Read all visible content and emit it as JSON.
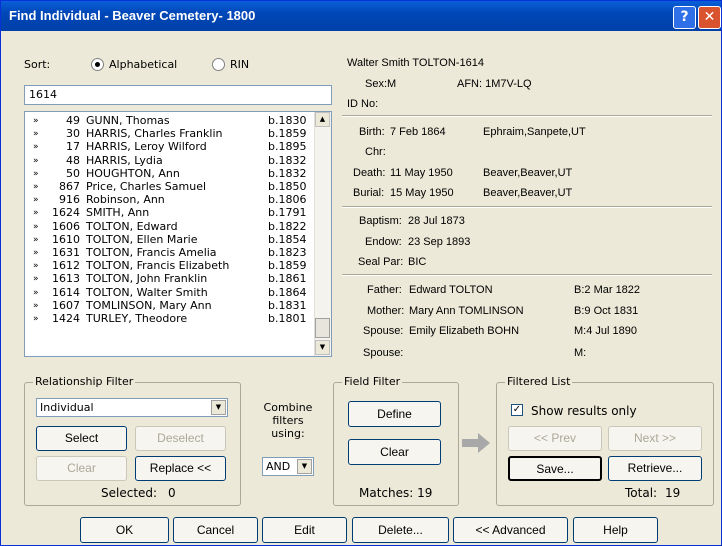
{
  "window": {
    "title": "Find Individual - Beaver Cemetery- 1800",
    "help_glyph": "?",
    "close_glyph": "✕"
  },
  "sort": {
    "label": "Sort:",
    "options": [
      {
        "label": "Alphabetical",
        "selected": true
      },
      {
        "label": "RIN",
        "selected": false
      }
    ]
  },
  "search": {
    "value": "1614"
  },
  "list": {
    "rows": [
      {
        "num": "49",
        "name": "GUNN, Thomas",
        "birth": "b.1830"
      },
      {
        "num": "30",
        "name": "HARRIS, Charles Franklin",
        "birth": "b.1859"
      },
      {
        "num": "17",
        "name": "HARRIS, Leroy Wilford",
        "birth": "b.1895"
      },
      {
        "num": "48",
        "name": "HARRIS, Lydia",
        "birth": "b.1832"
      },
      {
        "num": "50",
        "name": "HOUGHTON, Ann",
        "birth": "b.1832"
      },
      {
        "num": "867",
        "name": "Price, Charles Samuel",
        "birth": "b.1850"
      },
      {
        "num": "916",
        "name": "Robinson, Ann",
        "birth": "b.1806"
      },
      {
        "num": "1624",
        "name": "SMITH, Ann",
        "birth": "b.1791"
      },
      {
        "num": "1606",
        "name": "TOLTON, Edward",
        "birth": "b.1822"
      },
      {
        "num": "1610",
        "name": "TOLTON, Ellen Marie",
        "birth": "b.1854"
      },
      {
        "num": "1631",
        "name": "TOLTON, Francis Amelia",
        "birth": "b.1823"
      },
      {
        "num": "1612",
        "name": "TOLTON, Francis Elizabeth",
        "birth": "b.1859"
      },
      {
        "num": "1613",
        "name": "TOLTON, John Franklin",
        "birth": "b.1861"
      },
      {
        "num": "1614",
        "name": "TOLTON, Walter Smith",
        "birth": "b.1864"
      },
      {
        "num": "1607",
        "name": "TOMLINSON, Mary Ann",
        "birth": "b.1831"
      },
      {
        "num": "1424",
        "name": "TURLEY, Theodore",
        "birth": "b.1801"
      }
    ],
    "arrow": "»"
  },
  "details": {
    "header": "Walter Smith TOLTON-1614",
    "sex": "Sex:M",
    "afn": "AFN: 1M7V-LQ",
    "id_no": "ID No:",
    "birth_label": "Birth:",
    "birth_date": "7 Feb 1864",
    "birth_place": "Ephraim,Sanpete,UT",
    "chr_label": "Chr:",
    "death_label": "Death:",
    "death_date": "11 May 1950",
    "death_place": "Beaver,Beaver,UT",
    "burial_label": "Burial:",
    "burial_date": "15 May 1950",
    "burial_place": "Beaver,Beaver,UT",
    "baptism_label": "Baptism:",
    "baptism_date": "28 Jul 1873",
    "endow_label": "Endow:",
    "endow_date": "23 Sep 1893",
    "sealpar_label": "Seal Par:",
    "sealpar_value": "BIC",
    "father_label": "Father:",
    "father_name": "Edward TOLTON",
    "father_b": "B:2 Mar 1822",
    "mother_label": "Mother:",
    "mother_name": "Mary Ann TOMLINSON",
    "mother_b": "B:9 Oct 1831",
    "spouse1_label": "Spouse:",
    "spouse1_name": "Emily Elizabeth BOHN",
    "spouse1_m": "M:4 Jul 1890",
    "spouse2_label": "Spouse:",
    "spouse2_m": "M:"
  },
  "relationship_filter": {
    "title": "Relationship Filter",
    "selected": "Individual",
    "select": "Select",
    "deselect": "Deselect",
    "clear": "Clear",
    "replace": "Replace <<",
    "selected_label": "Selected:",
    "selected_count": "0"
  },
  "combine": {
    "line1": "Combine",
    "line2": "filters",
    "line3": "using:",
    "value": "AND"
  },
  "field_filter": {
    "title": "Field Filter",
    "define": "Define",
    "clear": "Clear",
    "matches": "Matches: 19"
  },
  "filtered_list": {
    "title": "Filtered List",
    "show_results_only": "Show results only",
    "checked": true,
    "prev": "<< Prev",
    "next": "Next >>",
    "save": "Save...",
    "retrieve": "Retrieve...",
    "total_label": "Total:",
    "total": "19"
  },
  "footer": {
    "ok": "OK",
    "cancel": "Cancel",
    "edit": "Edit",
    "delete": "Delete...",
    "advanced": "<< Advanced",
    "help": "Help"
  },
  "colors": {
    "title_bar": "#0047b8",
    "face": "#ece9d8"
  }
}
